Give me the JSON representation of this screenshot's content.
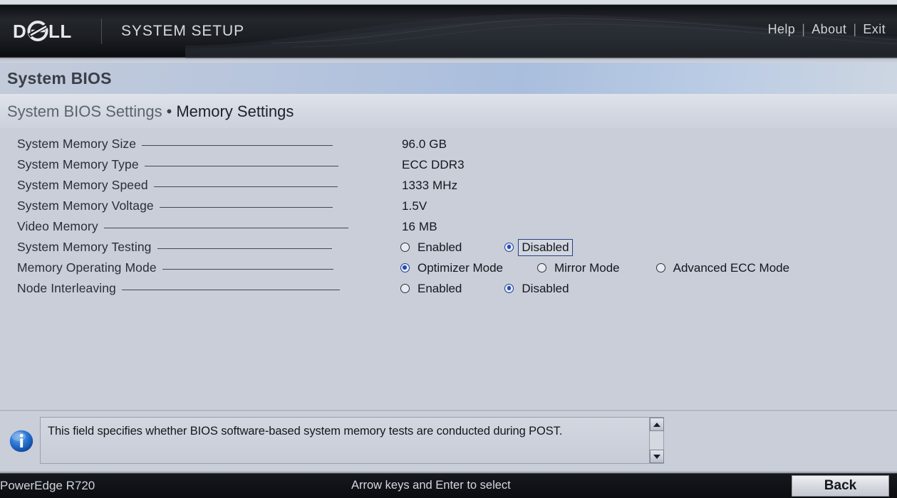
{
  "header": {
    "logo_text": "DELL",
    "title": "SYSTEM SETUP",
    "links": [
      {
        "label": "Help"
      },
      {
        "label": "About"
      },
      {
        "label": "Exit"
      }
    ],
    "separator": "|"
  },
  "band": {
    "title": "System BIOS"
  },
  "breadcrumb": {
    "parent": "System BIOS Settings",
    "dot": "•",
    "current": "Memory Settings"
  },
  "settings": [
    {
      "label": "System Memory Size",
      "type": "text",
      "value": "96.0 GB",
      "leader_width": 268
    },
    {
      "label": "System Memory Type",
      "type": "text",
      "value": "ECC DDR3",
      "leader_width": 272
    },
    {
      "label": "System Memory Speed",
      "type": "text",
      "value": "1333 MHz",
      "leader_width": 258
    },
    {
      "label": "System Memory Voltage",
      "type": "text",
      "value": "1.5V",
      "leader_width": 243
    },
    {
      "label": "Video Memory",
      "type": "text",
      "value": "16 MB",
      "leader_width": 343
    },
    {
      "label": "System Memory Testing",
      "type": "radio",
      "leader_width": 245,
      "options": [
        {
          "label": "Enabled",
          "selected": false,
          "focused": false,
          "gap": 0
        },
        {
          "label": "Disabled",
          "selected": true,
          "focused": true,
          "gap": 56
        }
      ]
    },
    {
      "label": "Memory Operating Mode",
      "type": "radio",
      "leader_width": 240,
      "options": [
        {
          "label": "Optimizer Mode",
          "selected": true,
          "focused": false,
          "gap": 0
        },
        {
          "label": "Mirror Mode",
          "selected": false,
          "focused": false,
          "gap": 44
        },
        {
          "label": "Advanced ECC Mode",
          "selected": false,
          "focused": false,
          "gap": 47
        }
      ]
    },
    {
      "label": "Node Interleaving",
      "type": "radio",
      "leader_width": 306,
      "options": [
        {
          "label": "Enabled",
          "selected": false,
          "focused": false,
          "gap": 0
        },
        {
          "label": "Disabled",
          "selected": true,
          "focused": false,
          "gap": 56
        }
      ]
    }
  ],
  "help": {
    "icon": "info-icon",
    "text": "This field specifies whether BIOS software-based system memory tests are conducted during POST.",
    "scroll_up_icon": "scroll-up-arrow-icon",
    "scroll_down_icon": "scroll-down-arrow-icon"
  },
  "footer": {
    "model": "PowerEdge R720",
    "hint": "Arrow keys and Enter to select",
    "back_label": "Back"
  },
  "colors": {
    "background": "#c9ced9",
    "header_dark": "#15181d",
    "band_blue": "#a9bedd",
    "radio_selected": "#1b49c4",
    "focus_outline": "#2d3f8c",
    "info_blue": "#1a62c8"
  }
}
